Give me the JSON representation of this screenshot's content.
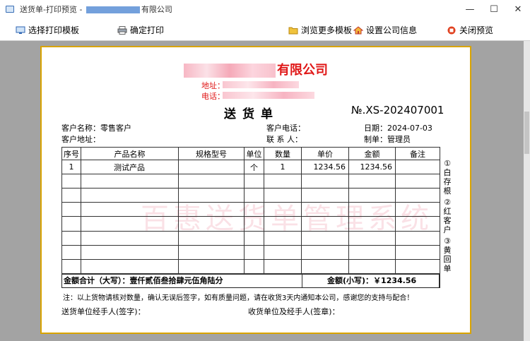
{
  "window": {
    "title_prefix": "送货单-打印预览 - ",
    "title_suffix": "有限公司",
    "minimize": "—",
    "maximize": "☐",
    "close": "✕"
  },
  "toolbar": {
    "select_template": "选择打印模板",
    "confirm_print": "确定打印",
    "browse_templates": "浏览更多模板",
    "company_settings": "设置公司信息",
    "close_preview": "关闭预览"
  },
  "header": {
    "company_visible": "有限公司",
    "address_label": "地址：",
    "phone_label": "电话：",
    "doc_title": "送货单",
    "doc_no": "№.XS-202407001"
  },
  "info": {
    "customer_name_label": "客户名称：",
    "customer_name": "零售客户",
    "customer_phone_label": "客户电话：",
    "date_label": "日期：",
    "date": "2024-07-03",
    "customer_address_label": "客户地址：",
    "contact_label": "联 系 人：",
    "maker_label": "制单：",
    "maker": "管理员"
  },
  "table": {
    "columns": [
      "序号",
      "产品名称",
      "规格型号",
      "单位",
      "数量",
      "单价",
      "金额",
      "备注"
    ],
    "rows": [
      [
        "1",
        "测试产品",
        "",
        "个",
        "1",
        "1234.56",
        "1234.56",
        ""
      ]
    ]
  },
  "totals": {
    "upper_label": "金额合计（大写）：",
    "upper_value": "壹仟贰佰叁拾肆元伍角陆分",
    "lower_label": "金额(小写)：",
    "lower_value": "￥1234.56"
  },
  "side_notes": [
    "①白存根",
    "②红客户",
    "③黄回单"
  ],
  "watermark": "百惠送货单管理系统",
  "footer": {
    "note": "注：以上货物请核对数量，确认无误后签字，如有质量问题，请在收货3天内通知本公司，感谢您的支持与配合！",
    "sender_sign": "送货单位经手人(签字)：",
    "receiver_sign": "收货单位及经手人(签章)："
  },
  "colors": {
    "company_red": "#e01818",
    "paper_border": "#d9a400",
    "work_gray": "#a3a3a3"
  }
}
